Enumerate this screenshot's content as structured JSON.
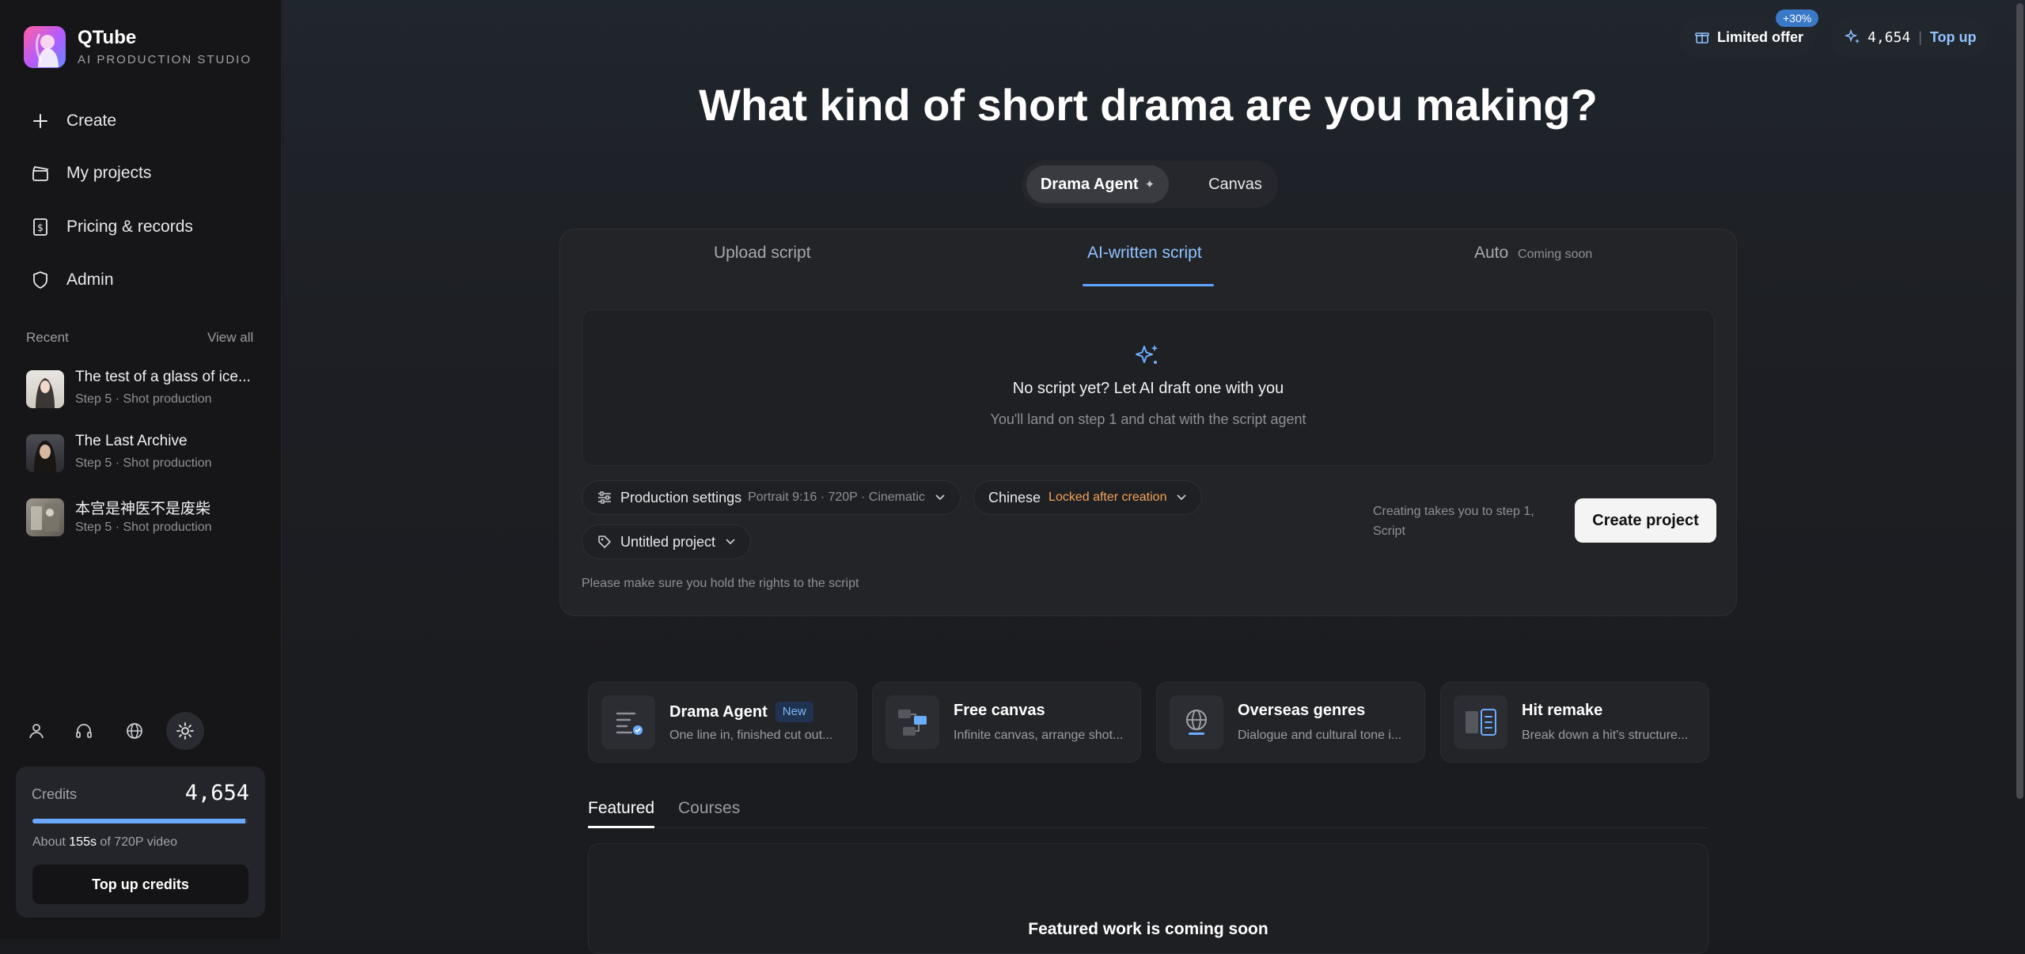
{
  "brand": {
    "name": "QTube",
    "subtitle": "AI PRODUCTION STUDIO"
  },
  "sidebar": {
    "nav": [
      {
        "label": "Create",
        "icon": "plus-icon"
      },
      {
        "label": "My projects",
        "icon": "clapperboard-icon"
      },
      {
        "label": "Pricing & records",
        "icon": "dollar-receipt-icon"
      },
      {
        "label": "Admin",
        "icon": "shield-icon"
      }
    ],
    "recent_heading": "Recent",
    "view_all": "View all",
    "recent": [
      {
        "title": "The test of a glass of ice...",
        "step": "Step 5 · Shot production"
      },
      {
        "title": "The Last Archive",
        "step": "Step 5 · Shot production"
      },
      {
        "title": "本宫是神医不是废柴",
        "step": "Step 5 · Shot production"
      }
    ],
    "tools": [
      "user-icon",
      "headset-icon",
      "globe-icon",
      "sun-icon"
    ],
    "credits": {
      "label": "Credits",
      "value": "4,654",
      "progress": 0.99,
      "about_prefix": "About",
      "about_amount": "155s",
      "about_suffix": "of 720P video",
      "button": "Top up credits"
    }
  },
  "topbar": {
    "offer_label": "Limited offer",
    "offer_badge": "+30%",
    "credits_value": "4,654",
    "separator": "|",
    "topup": "Top up"
  },
  "hero": {
    "title": "What kind of short drama are you making?"
  },
  "mode_switch": {
    "active": "Drama Agent",
    "active_suffix": "✦",
    "other": "Canvas"
  },
  "panel": {
    "tabs": [
      {
        "label": "Upload script"
      },
      {
        "label": "AI-written script"
      },
      {
        "label": "Auto",
        "suffix": "Coming soon"
      }
    ],
    "empty_title": "No script yet? Let AI draft one with you",
    "empty_sub": "You'll land on step 1 and chat with the script agent",
    "production_label": "Production settings",
    "production_value": "Portrait 9:16 · 720P · Cinematic",
    "language_label": "Chinese",
    "language_note": "Locked after creation",
    "project_name": "Untitled project",
    "create_note": "Creating takes you to step 1, Script",
    "create_button": "Create project",
    "rights_note": "Please make sure you hold the rights to the script"
  },
  "features": [
    {
      "title": "Drama Agent",
      "badge": "New",
      "desc": "One line in, finished cut out..."
    },
    {
      "title": "Free canvas",
      "desc": "Infinite canvas, arrange shot..."
    },
    {
      "title": "Overseas genres",
      "desc": "Dialogue and cultural tone i..."
    },
    {
      "title": "Hit remake",
      "desc": "Break down a hit's structure..."
    }
  ],
  "feature_tabs": [
    "Featured",
    "Courses"
  ],
  "featured_message": "Featured work is coming soon",
  "colors": {
    "accent": "#5ea6ff",
    "warning": "#f0a35a",
    "background": "#1a1b1f"
  }
}
